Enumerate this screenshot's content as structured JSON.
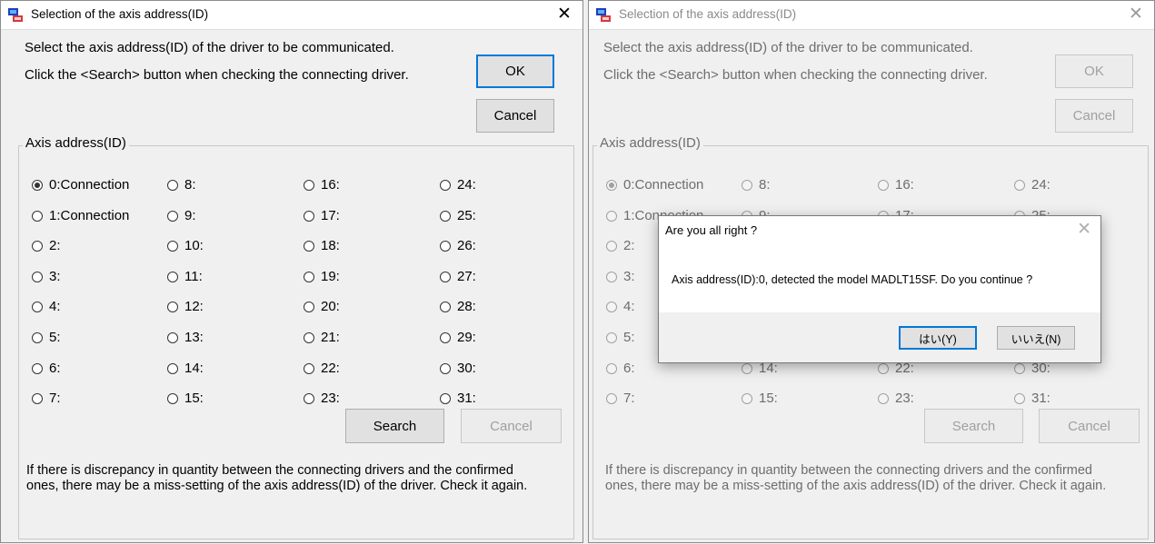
{
  "window": {
    "title": "Selection of the axis address(ID)",
    "close_glyph": "✕",
    "instruction_1": "Select the axis address(ID) of the driver to be communicated.",
    "instruction_2": "Click the <Search> button when checking the connecting driver.",
    "ok_label": "OK",
    "cancel_label": "Cancel",
    "group_title": "Axis address(ID)",
    "search_label": "Search",
    "cancel2_label": "Cancel",
    "note": "If there is discrepancy in quantity between the connecting drivers and the confirmed ones, there may be a miss-setting of the axis address(ID) of the driver. Check it again.",
    "selected_index": 0
  },
  "axis_options": [
    "0:Connection",
    "1:Connection",
    "2:",
    "3:",
    "4:",
    "5:",
    "6:",
    "7:",
    "8:",
    "9:",
    "10:",
    "11:",
    "12:",
    "13:",
    "14:",
    "15:",
    "16:",
    "17:",
    "18:",
    "19:",
    "20:",
    "21:",
    "22:",
    "23:",
    "24:",
    "25:",
    "26:",
    "27:",
    "28:",
    "29:",
    "30:",
    "31:"
  ],
  "dialog": {
    "title": "Are you all right ?",
    "close_glyph": "✕",
    "message": "Axis address(ID):0, detected the model MADLT15SF. Do you continue ?",
    "yes_label": "はい(Y)",
    "no_label": "いいえ(N)"
  },
  "colors": {
    "accent": "#0078d7",
    "window_bg": "#f0f0f0",
    "disabled_text": "#a0a0a0"
  }
}
